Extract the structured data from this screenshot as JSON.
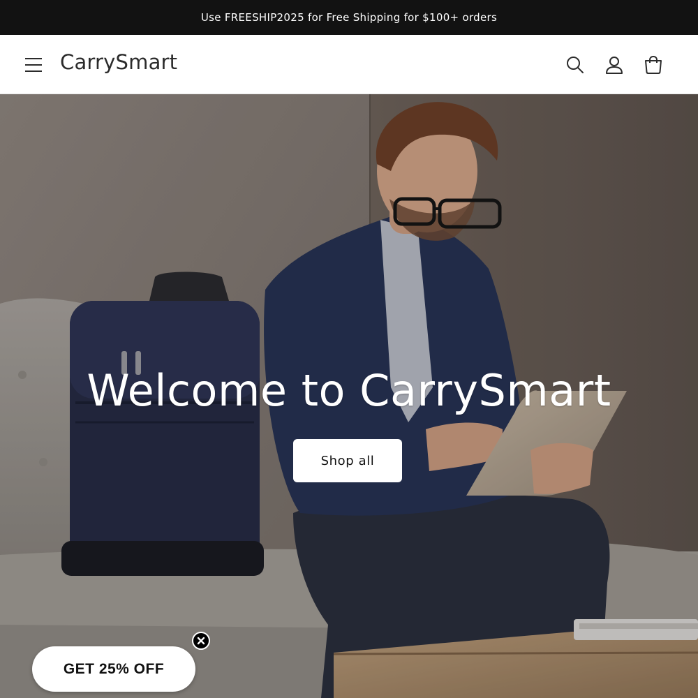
{
  "announcement": {
    "text": "Use FREESHIP2025 for Free Shipping for $100+ orders"
  },
  "header": {
    "logo": "CarrySmart",
    "icons": [
      "hamburger-menu-icon",
      "search-icon",
      "account-icon",
      "cart-icon"
    ]
  },
  "hero": {
    "title": "Welcome to CarrySmart",
    "cta_label": "Shop all"
  },
  "promo": {
    "label": "GET 25% OFF"
  },
  "colors": {
    "announcement_bg": "#121212",
    "header_bg": "#ffffff",
    "text_dark": "#121212",
    "button_bg": "#ffffff"
  }
}
